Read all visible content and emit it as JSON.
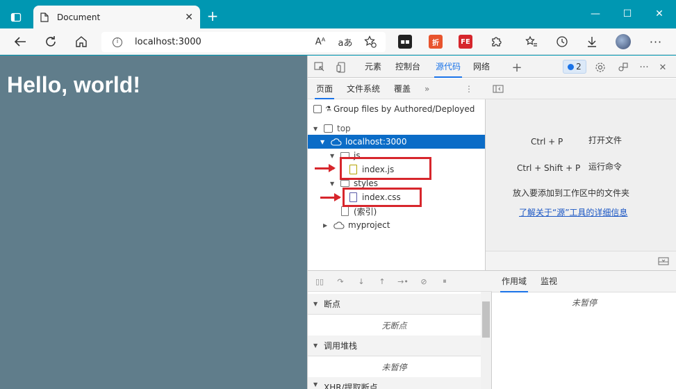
{
  "browser": {
    "tab_title": "Document",
    "url": "localhost:3000",
    "read_aloud": "Aᴬ",
    "translate": "aあ"
  },
  "page": {
    "heading": "Hello, world!"
  },
  "devtools": {
    "tabs": [
      "元素",
      "控制台",
      "源代码",
      "网络"
    ],
    "active_tab": "源代码",
    "issues_count": "2",
    "navigator": {
      "tabs": [
        "页面",
        "文件系统",
        "覆盖"
      ],
      "group_label": "Group files by Authored/Deployed",
      "tree": {
        "top": "top",
        "host": "localhost:3000",
        "js_folder": "js",
        "js_file": "index.js",
        "styles_folder": "styles",
        "css_file": "index.css",
        "index": "(索引)",
        "project": "myproject"
      }
    },
    "editor": {
      "shortcut1_keys": "Ctrl + P",
      "shortcut1_label": "打开文件",
      "shortcut2_keys": "Ctrl + Shift + P",
      "shortcut2_label": "运行命令",
      "drop_hint": "放入要添加到工作区中的文件夹",
      "learn_more": "了解关于“源”工具的详细信息"
    },
    "debugger": {
      "breakpoints_label": "断点",
      "no_breakpoints": "无断点",
      "callstack_label": "调用堆栈",
      "not_paused": "未暂停",
      "xhr_label": "XHR/提取断点"
    },
    "scope": {
      "tabs": [
        "作用域",
        "监视"
      ],
      "not_paused": "未暂停"
    }
  },
  "colors": {
    "titlebar": "#0097b2",
    "content_bg": "#607d8b",
    "selected_row": "#0b6cc7",
    "annotation": "#d7262c"
  }
}
